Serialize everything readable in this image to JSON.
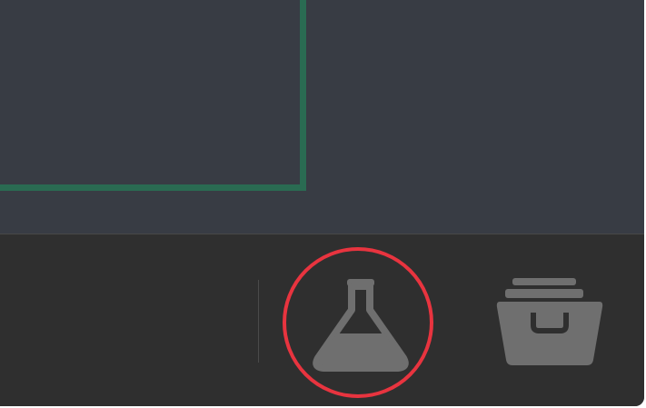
{
  "toolbar": {
    "buttons": [
      {
        "id": "experiments",
        "icon": "flask-icon",
        "highlighted": true
      },
      {
        "id": "archive",
        "icon": "archive-box-icon",
        "highlighted": false
      }
    ]
  },
  "colors": {
    "content_bg": "#383c44",
    "toolbar_bg": "#2f2f2f",
    "selection_border": "#2a6b52",
    "icon_gray": "#6f6f6f",
    "highlight_ring": "#e8343f"
  }
}
